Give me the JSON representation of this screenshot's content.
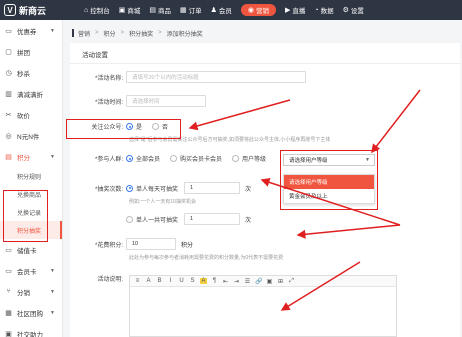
{
  "topbar": {
    "logo": "新商云",
    "logo_mark": "V",
    "nav": [
      {
        "label": "控制台",
        "icon": "home-icon"
      },
      {
        "label": "商城",
        "icon": "shop-icon"
      },
      {
        "label": "商品",
        "icon": "goods-icon"
      },
      {
        "label": "订单",
        "icon": "order-icon"
      },
      {
        "label": "会员",
        "icon": "member-icon"
      },
      {
        "label": "营销",
        "icon": "marketing-icon"
      },
      {
        "label": "直播",
        "icon": "live-icon"
      },
      {
        "label": "数据",
        "icon": "data-icon"
      },
      {
        "label": "设置",
        "icon": "settings-icon"
      }
    ],
    "accent": "#f0563f"
  },
  "sidebar": {
    "items": [
      {
        "label": "优惠券",
        "icon": "coupon-icon"
      },
      {
        "label": "拼团",
        "icon": "group-icon"
      },
      {
        "label": "秒杀",
        "icon": "flash-sale-icon"
      },
      {
        "label": "满减满折",
        "icon": "discount-icon"
      },
      {
        "label": "砍价",
        "icon": "bargain-icon"
      },
      {
        "label": "N元N件",
        "icon": "bundle-icon"
      },
      {
        "label": "积分",
        "icon": "points-icon"
      }
    ],
    "sub_items": [
      "积分规则",
      "兑换商品",
      "兑换记录",
      "积分抽奖"
    ],
    "bottom_items": [
      {
        "label": "储值卡",
        "icon": "card-icon"
      },
      {
        "label": "会员卡",
        "icon": "vip-card-icon"
      },
      {
        "label": "分销",
        "icon": "distribution-icon"
      },
      {
        "label": "社区团购",
        "icon": "community-icon"
      },
      {
        "label": "社交助力",
        "icon": "social-icon"
      }
    ]
  },
  "breadcrumb": [
    "营销",
    "积分",
    "积分抽奖",
    "添加积分抽奖"
  ],
  "panel": {
    "title": "活动设置",
    "name_label": "*活动名称:",
    "name_placeholder": "请填写20个以内的活动标题",
    "time_label": "*活动时间:",
    "time_placeholder": "请选择时间",
    "follow_label": "关注公众号:",
    "follow_yes": "是",
    "follow_no": "否",
    "follow_hint": "选择\"是\"后参与会员需关注公众号后方可抽奖,如须要将此公众号主体,小小程序再账号下主体",
    "join_label": "*参与人群:",
    "join_all": "全部会员",
    "join_card": "购买会员卡会员",
    "join_level": "用户等级",
    "level_select": "请选择用户等级",
    "level_options": [
      "请选择用户等级",
      "黄金会员及以上"
    ],
    "times_label": "*抽奖次数:",
    "times_day": "单人每天可抽奖",
    "times_day_value": "1",
    "times_unit": "次",
    "times_hint": "例如:一个人一天有10抽奖机会",
    "times_total": "单人一共可抽奖",
    "times_total_value": "1",
    "cost_label": "*花费积分:",
    "cost_value": "10",
    "cost_unit": "积分",
    "cost_hint": "此处为参与每次参与者消耗用需要花费的积分数量,为0代表不需要花费",
    "desc_label": "活动说明:",
    "editor_tools": [
      "≡",
      "A",
      "B",
      "I",
      "U",
      "S",
      "A",
      "¶",
      "⇤",
      "⇥",
      "☰",
      "🔗",
      "▣",
      "⊞",
      "⤢"
    ]
  }
}
